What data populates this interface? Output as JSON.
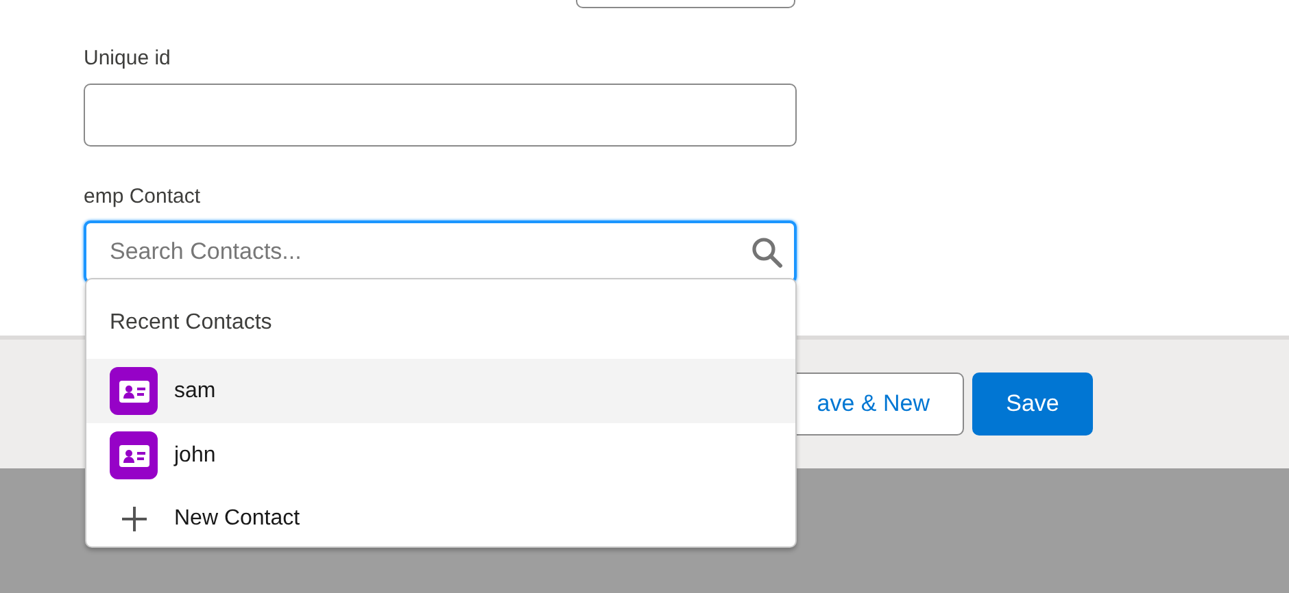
{
  "fields": [
    {
      "label": "Unique id"
    },
    {
      "label": "emp Contact",
      "placeholder": "Search Contacts...",
      "focused": true
    }
  ],
  "dropdown": {
    "heading": "Recent Contacts",
    "items": [
      {
        "kind": "record",
        "label": "sam",
        "selected": true
      },
      {
        "kind": "record",
        "label": "john",
        "selected": false
      },
      {
        "kind": "action",
        "label": "New Contact",
        "selected": false
      }
    ]
  },
  "footer": {
    "buttons": [
      {
        "kind": "neutral",
        "label": "ave & New"
      },
      {
        "kind": "brand",
        "label": "Save"
      }
    ]
  }
}
